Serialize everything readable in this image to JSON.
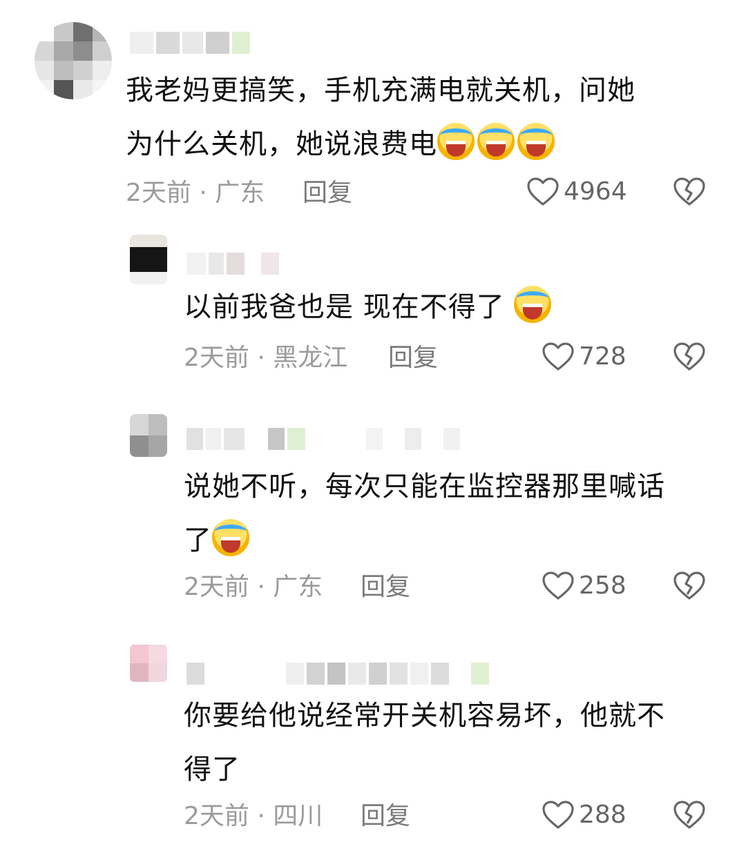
{
  "comments": [
    {
      "text_lines": [
        "我老妈更搞笑，手机充满电就关机，问她",
        "为什么关机，她说浪费电"
      ],
      "emoji_count": 3,
      "time": "2天前",
      "location": "广东",
      "reply_label": "回复",
      "likes": "4964"
    },
    {
      "text_lines": [
        "以前我爸也是 现在不得了"
      ],
      "emoji_count": 1,
      "time": "2天前",
      "location": "黑龙江",
      "reply_label": "回复",
      "likes": "728"
    },
    {
      "text_lines": [
        "说她不听，每次只能在监控器那里喊话",
        "了"
      ],
      "emoji_count": 1,
      "time": "2天前",
      "location": "广东",
      "reply_label": "回复",
      "likes": "258"
    },
    {
      "text_lines": [
        "你要给他说经常开关机容易坏，他就不",
        "得了"
      ],
      "emoji_count": 0,
      "time": "2天前",
      "location": "四川",
      "reply_label": "回复",
      "likes": "288"
    }
  ],
  "icons": {
    "emoji": "laughing-crying-emoji-icon",
    "like": "heart-outline-icon",
    "dislike": "broken-heart-icon"
  },
  "colors": {
    "text": "#111111",
    "meta": "#9b9b9b",
    "icon": "#666666"
  }
}
